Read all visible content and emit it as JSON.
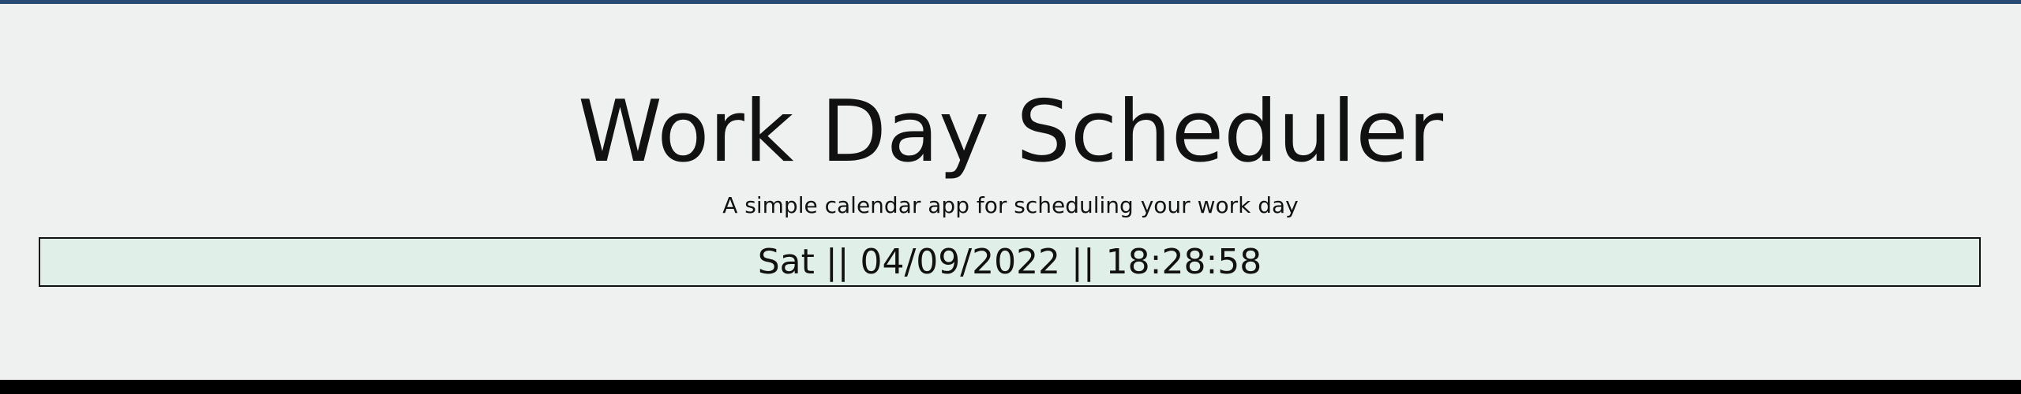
{
  "header": {
    "title": "Work Day Scheduler",
    "subtitle": "A simple calendar app for scheduling your work day",
    "current_day": "Sat || 04/09/2022 || 18:28:58"
  },
  "colors": {
    "background": "#eef1ef",
    "top_accent": "#274b72",
    "date_bar_background": "#e1efe9",
    "date_bar_border": "#111111",
    "bottom_bar": "#000000"
  }
}
